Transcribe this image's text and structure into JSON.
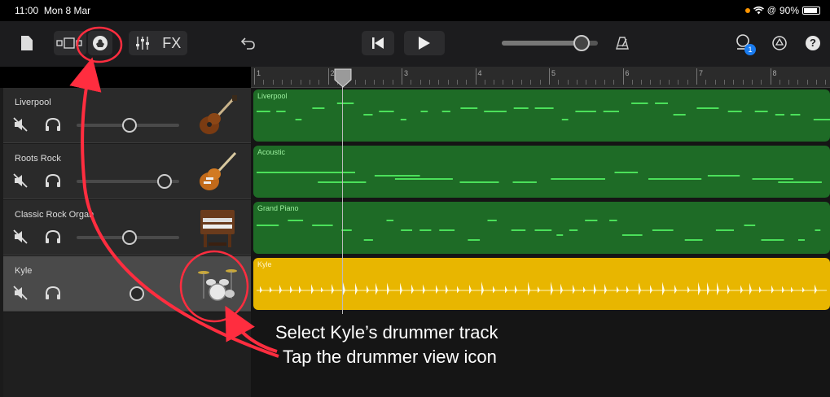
{
  "status_bar": {
    "time": "11:00",
    "date": "Mon 8 Mar",
    "battery": "90%"
  },
  "toolbar": {
    "fx_label": "FX",
    "notification_count": "1",
    "help_label": "?"
  },
  "ruler": {
    "bars": [
      "1",
      "2",
      "3",
      "4",
      "5",
      "6",
      "7",
      "8"
    ]
  },
  "tracks": [
    {
      "name": "Liverpool",
      "region_label": "Liverpool",
      "instrument": "bass-guitar-icon",
      "volume": 0.52
    },
    {
      "name": "Roots Rock",
      "region_label": "Acoustic",
      "instrument": "electric-guitar-icon",
      "volume": 0.92
    },
    {
      "name": "Classic Rock Organ",
      "region_label": "Grand Piano",
      "instrument": "organ-icon",
      "volume": 0.52
    },
    {
      "name": "Kyle",
      "region_label": "Kyle",
      "instrument": "drum-kit-icon",
      "volume": 0.6
    }
  ],
  "annotation": {
    "line1": "Select Kyle’s drummer track",
    "line2": "Tap the drummer view icon"
  },
  "colors": {
    "midi_region": "#1e6b26",
    "midi_note": "#4be05a",
    "drummer_region": "#e8b600",
    "annotation_red": "#ff2d3f"
  }
}
